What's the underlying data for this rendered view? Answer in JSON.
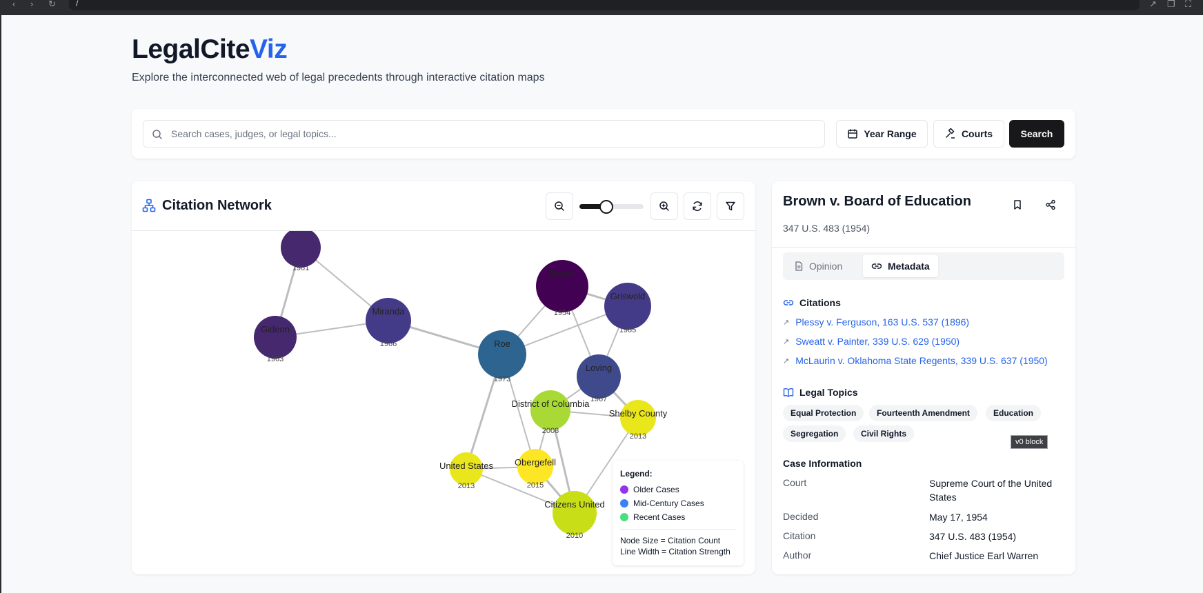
{
  "browser": {
    "url": "/"
  },
  "brand": {
    "name_main": "LegalCite",
    "name_accent": "Viz",
    "tagline": "Explore the interconnected web of legal precedents through interactive citation maps"
  },
  "search": {
    "placeholder": "Search cases, judges, or legal topics...",
    "value": "",
    "year_range_label": "Year Range",
    "courts_label": "Courts",
    "submit_label": "Search"
  },
  "network": {
    "title": "Citation Network",
    "zoom_level": 0.4,
    "nodes": [
      {
        "id": "mapp",
        "label": "",
        "year": "1961",
        "color": "#46286e"
      },
      {
        "id": "gideon",
        "label": "Gideon",
        "year": "1963",
        "color": "#46286e"
      },
      {
        "id": "miranda",
        "label": "Miranda",
        "year": "1966",
        "color": "#433b88"
      },
      {
        "id": "roe",
        "label": "Roe",
        "year": "1973",
        "color": "#2d6590"
      },
      {
        "id": "brown",
        "label": "Brown",
        "year": "1954",
        "color": "#420152"
      },
      {
        "id": "griswold",
        "label": "Griswold",
        "year": "1965",
        "color": "#433b88"
      },
      {
        "id": "loving",
        "label": "Loving",
        "year": "1967",
        "color": "#3e4a8b"
      },
      {
        "id": "dc",
        "label": "District of Columbia",
        "year": "2008",
        "color": "#a9d934"
      },
      {
        "id": "shelby",
        "label": "Shelby County",
        "year": "2013",
        "color": "#e9e61c"
      },
      {
        "id": "us",
        "label": "United States",
        "year": "2013",
        "color": "#e9e61c"
      },
      {
        "id": "obergefell",
        "label": "Obergefell",
        "year": "2015",
        "color": "#fde725"
      },
      {
        "id": "citizens",
        "label": "Citizens United",
        "year": "2010",
        "color": "#c8df18"
      }
    ],
    "edges": [
      [
        "mapp",
        "gideon"
      ],
      [
        "mapp",
        "miranda"
      ],
      [
        "gideon",
        "miranda"
      ],
      [
        "miranda",
        "roe"
      ],
      [
        "roe",
        "brown"
      ],
      [
        "roe",
        "griswold"
      ],
      [
        "brown",
        "griswold"
      ],
      [
        "brown",
        "loving"
      ],
      [
        "griswold",
        "loving"
      ],
      [
        "roe",
        "us"
      ],
      [
        "roe",
        "obergefell"
      ],
      [
        "loving",
        "dc"
      ],
      [
        "loving",
        "shelby"
      ],
      [
        "dc",
        "shelby"
      ],
      [
        "dc",
        "obergefell"
      ],
      [
        "dc",
        "citizens"
      ],
      [
        "us",
        "obergefell"
      ],
      [
        "us",
        "citizens"
      ],
      [
        "obergefell",
        "citizens"
      ],
      [
        "shelby",
        "citizens"
      ]
    ],
    "legend": {
      "title": "Legend:",
      "items": [
        {
          "label": "Older Cases",
          "color": "#9333ea"
        },
        {
          "label": "Mid-Century Cases",
          "color": "#3b82f6"
        },
        {
          "label": "Recent Cases",
          "color": "#4ade80"
        }
      ],
      "note_size": "Node Size = Citation Count",
      "note_width": "Line Width = Citation Strength"
    }
  },
  "case": {
    "title": "Brown v. Board of Education",
    "citation_line": "347 U.S. 483 (1954)",
    "tabs": [
      {
        "label": "Opinion"
      },
      {
        "label": "Metadata"
      }
    ],
    "citations_title": "Citations",
    "citations": [
      "Plessy v. Ferguson, 163 U.S. 537 (1896)",
      "Sweatt v. Painter, 339 U.S. 629 (1950)",
      "McLaurin v. Oklahoma State Regents, 339 U.S. 637 (1950)"
    ],
    "topics_title": "Legal Topics",
    "topics": [
      "Equal Protection",
      "Fourteenth Amendment",
      "Education",
      "Segregation",
      "Civil Rights"
    ],
    "badge": "v0 block",
    "info_title": "Case Information",
    "info": [
      {
        "key": "Court",
        "value": "Supreme Court of the United States"
      },
      {
        "key": "Decided",
        "value": "May 17, 1954"
      },
      {
        "key": "Citation",
        "value": "347 U.S. 483 (1954)"
      },
      {
        "key": "Author",
        "value": "Chief Justice Earl Warren"
      }
    ]
  }
}
